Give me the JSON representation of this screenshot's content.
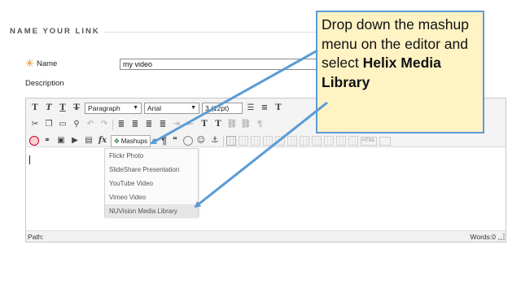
{
  "section": {
    "title": "NAME YOUR LINK"
  },
  "form": {
    "name_label": "Name",
    "required_star": "✳",
    "name_value": "my video",
    "description_label": "Description"
  },
  "toolbar": {
    "row1": {
      "bold": "T",
      "italic": "T",
      "underline": "T",
      "strikethrough": "T",
      "format_select": "Paragraph",
      "font_select": "Arial",
      "size_select": "3 (12pt)"
    },
    "row3": {
      "function_label": "fx",
      "mashups_label": "Mashups",
      "paragraph_mark": "¶",
      "quote_mark": "❝",
      "html_label": "HTML"
    }
  },
  "mashups_menu": {
    "items": [
      "Flickr Photo",
      "SlideShare Presentation",
      "YouTube Video",
      "Vimeo Video",
      "NUVision Media Library"
    ],
    "highlighted_index": 4
  },
  "status_bar": {
    "path_label": "Path:",
    "word_count": "Words:0"
  },
  "callout": {
    "text_before": "Drop down the mashup menu on the editor and select ",
    "text_bold": "Helix Media Library"
  },
  "colors": {
    "callout_background": "#fff3c4",
    "callout_border": "#5b9bd5",
    "arrow": "#5b9bd5",
    "required_star": "#e88b1c"
  }
}
